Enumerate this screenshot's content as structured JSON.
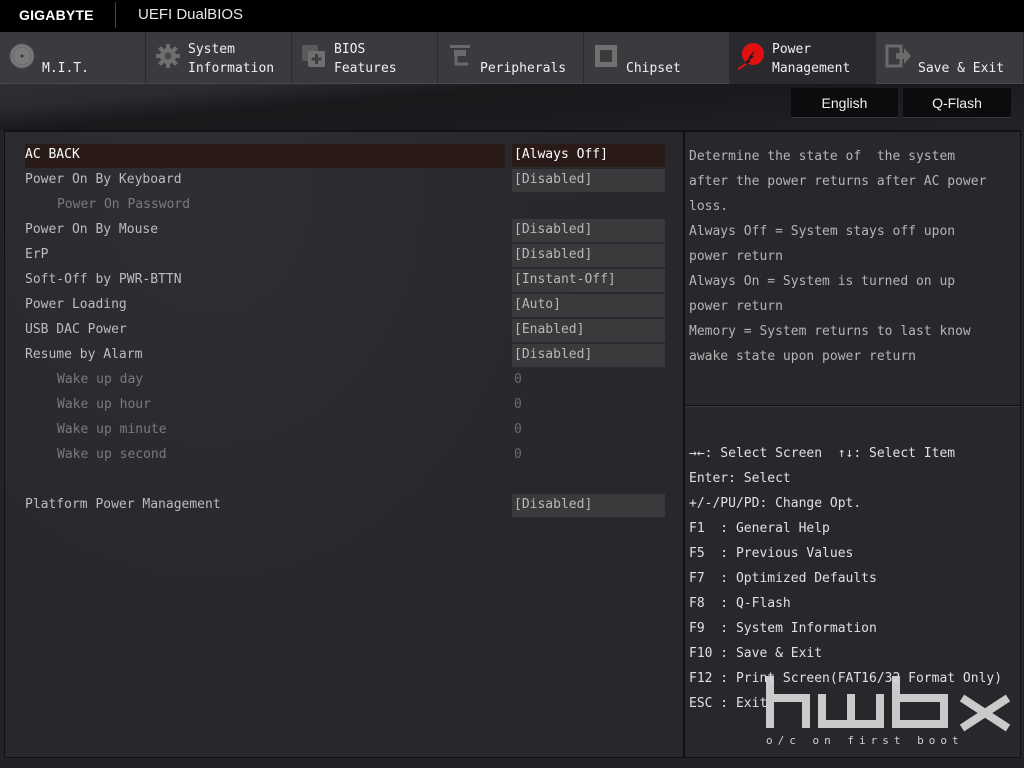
{
  "header": {
    "brand": "GIGABYTE",
    "brand_tm": "™",
    "product": "UEFI DualBIOS"
  },
  "tabs": [
    {
      "label": "M.I.T.",
      "icon": "speedometer-dial-icon",
      "active": false
    },
    {
      "label": "System\nInformation",
      "icon": "gear-icon",
      "active": false
    },
    {
      "label": "BIOS\nFeatures",
      "icon": "chip-plus-icon",
      "active": false
    },
    {
      "label": "Peripherals",
      "icon": "connector-plug-icon",
      "active": false
    },
    {
      "label": "Chipset",
      "icon": "chipset-icon",
      "active": false
    },
    {
      "label": "Power\nManagement",
      "icon": "power-lightning-icon",
      "active": true
    },
    {
      "label": "Save & Exit",
      "icon": "exit-door-icon",
      "active": false
    }
  ],
  "toolbar": {
    "language": "English",
    "qflash": "Q-Flash"
  },
  "settings": [
    {
      "label": "AC BACK",
      "value": "[Always Off]",
      "selected": true
    },
    {
      "label": "Power On By Keyboard",
      "value": "[Disabled]"
    },
    {
      "label": "Power On Password",
      "value": "",
      "sub": true
    },
    {
      "label": "Power On By Mouse",
      "value": "[Disabled]"
    },
    {
      "label": "ErP",
      "value": "[Disabled]"
    },
    {
      "label": "Soft-Off by PWR-BTTN",
      "value": "[Instant-Off]"
    },
    {
      "label": "Power Loading",
      "value": "[Auto]"
    },
    {
      "label": "USB DAC Power",
      "value": "[Enabled]"
    },
    {
      "label": "Resume by Alarm",
      "value": "[Disabled]"
    },
    {
      "label": "Wake up day",
      "value": "0",
      "sub": true
    },
    {
      "label": "Wake up hour",
      "value": "0",
      "sub": true
    },
    {
      "label": "Wake up minute",
      "value": "0",
      "sub": true
    },
    {
      "label": "Wake up second",
      "value": "0",
      "sub": true
    },
    {
      "label": "Platform Power Management",
      "value": "[Disabled]"
    }
  ],
  "help_text": [
    "Determine the state of  the system",
    "after the power returns after AC power",
    "loss.",
    "Always Off = System stays off upon",
    "power return",
    "Always On = System is turned on up",
    "power return",
    "Memory = System returns to last know",
    "awake state upon power return"
  ],
  "key_help": [
    "→←: Select Screen  ↑↓: Select Item",
    "Enter: Select",
    "+/-/PU/PD: Change Opt.",
    "F1  : General Help",
    "F5  : Previous Values",
    "F7  : Optimized Defaults",
    "F8  : Q-Flash",
    "F9  : System Information",
    "F10 : Save & Exit",
    "F12 : Print Screen(FAT16/32 Format Only)",
    "ESC : Exit"
  ],
  "watermark": {
    "logo": "hwbox",
    "tagline": "o/c on first boot"
  },
  "colors": {
    "accent_red": "#e01010",
    "selected_row": "#2a1a18"
  }
}
